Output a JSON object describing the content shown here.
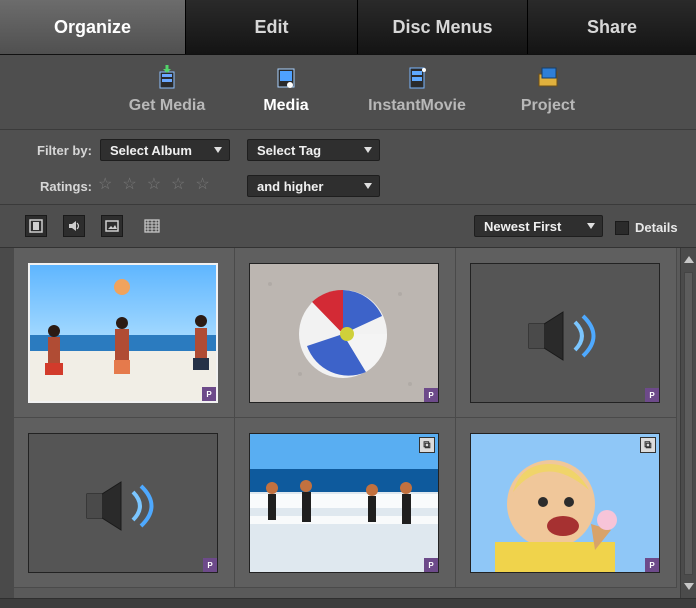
{
  "tabs": [
    {
      "label": "Organize"
    },
    {
      "label": "Edit"
    },
    {
      "label": "Disc Menus"
    },
    {
      "label": "Share"
    }
  ],
  "subnav": {
    "items": [
      {
        "label": "Get Media",
        "icon": "get-media-icon"
      },
      {
        "label": "Media",
        "icon": "media-icon"
      },
      {
        "label": "InstantMovie",
        "icon": "instant-movie-icon"
      },
      {
        "label": "Project",
        "icon": "project-icon"
      }
    ],
    "active": "Media"
  },
  "filters": {
    "filter_by_label": "Filter by:",
    "album_select": "Select Album",
    "tag_select": "Select Tag",
    "ratings_label": "Ratings:",
    "rating_mode": "and higher",
    "rating_value": 0,
    "rating_max": 5
  },
  "view": {
    "sort_select": "Newest First",
    "details_label": "Details",
    "details_checked": false
  },
  "grid": {
    "items": [
      {
        "kind": "photo",
        "description": "kids-beach-volleyball",
        "badge": "P",
        "selected": true
      },
      {
        "kind": "photo",
        "description": "beach-ball",
        "badge": "P"
      },
      {
        "kind": "audio",
        "description": "audio",
        "badge": "P"
      },
      {
        "kind": "audio",
        "description": "audio",
        "badge": "P"
      },
      {
        "kind": "photo",
        "description": "kids-surf",
        "badge": "P",
        "stack": true
      },
      {
        "kind": "photo",
        "description": "boy-ice-cream",
        "badge": "P",
        "stack": true
      }
    ]
  },
  "colors": {
    "badge_purple": "#6d4a8a",
    "tab_dark": "#1a1a1a",
    "panel": "#4e4e4e"
  }
}
